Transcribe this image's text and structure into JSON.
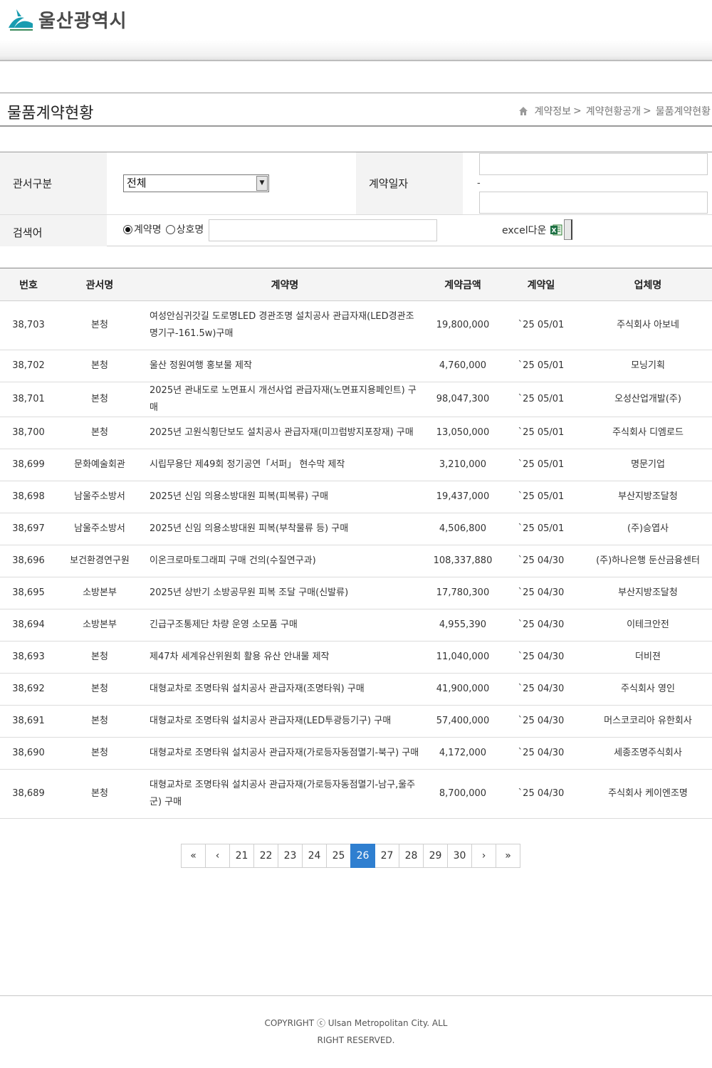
{
  "header": {
    "logo_text": "울산광역시",
    "colors": {
      "logo_blue": "#1a9cb0",
      "logo_green": "#3a8a5a"
    }
  },
  "title": {
    "text": "물품계약현황",
    "breadcrumb": [
      "계약정보",
      "계약현황공개",
      "물품계약현황"
    ],
    "breadcrumb_sep": ">"
  },
  "search": {
    "dept_label": "관서구분",
    "dept_selected": "전체",
    "date_label": "계약일자",
    "date_sep": "-",
    "keyword_label": "검색어",
    "radio_contract": "계약명",
    "radio_company": "상호명",
    "excel_label": "excel다운"
  },
  "table": {
    "headers": [
      "번호",
      "관서명",
      "계약명",
      "계약금액",
      "계약일",
      "업체명"
    ],
    "rows": [
      {
        "no": "38,703",
        "dept": "본청",
        "name": "여성안심귀갓길 도로명LED 경관조명 설치공사 관급자재(LED경관조명기구-161.5w)구매",
        "amount": "19,800,000",
        "date": "`25 05/01",
        "company": "주식회사 아보네"
      },
      {
        "no": "38,702",
        "dept": "본청",
        "name": "울산 정원여행 홍보물 제작",
        "amount": "4,760,000",
        "date": "`25 05/01",
        "company": "모닝기획"
      },
      {
        "no": "38,701",
        "dept": "본청",
        "name": "2025년 관내도로 노면표시 개선사업 관급자재(노면표지용페인트) 구매",
        "amount": "98,047,300",
        "date": "`25 05/01",
        "company": "오성산업개발(주)"
      },
      {
        "no": "38,700",
        "dept": "본청",
        "name": "2025년 고원식횡단보도 설치공사 관급자재(미끄럼방지포장재) 구매",
        "amount": "13,050,000",
        "date": "`25 05/01",
        "company": "주식회사 디엠로드"
      },
      {
        "no": "38,699",
        "dept": "문화예술회관",
        "name": "시립무용단 제49회 정기공연「서퍼」 현수막 제작",
        "amount": "3,210,000",
        "date": "`25 05/01",
        "company": "명문기업"
      },
      {
        "no": "38,698",
        "dept": "남울주소방서",
        "name": "2025년 신임 의용소방대원 피복(피복류) 구매",
        "amount": "19,437,000",
        "date": "`25 05/01",
        "company": "부산지방조달청"
      },
      {
        "no": "38,697",
        "dept": "남울주소방서",
        "name": "2025년 신임 의용소방대원 피복(부착물류 등) 구매",
        "amount": "4,506,800",
        "date": "`25 05/01",
        "company": "(주)승엽사"
      },
      {
        "no": "38,696",
        "dept": "보건환경연구원",
        "name": "이온크로마토그래피 구매 건의(수질연구과)",
        "amount": "108,337,880",
        "date": "`25 04/30",
        "company": "(주)하나은행 둔산금융센터"
      },
      {
        "no": "38,695",
        "dept": "소방본부",
        "name": "2025년 상반기 소방공무원 피복 조달 구매(신발류)",
        "amount": "17,780,300",
        "date": "`25 04/30",
        "company": "부산지방조달청"
      },
      {
        "no": "38,694",
        "dept": "소방본부",
        "name": "긴급구조통제단 차량 운영 소모품 구매",
        "amount": "4,955,390",
        "date": "`25 04/30",
        "company": "이테크안전"
      },
      {
        "no": "38,693",
        "dept": "본청",
        "name": "제47차 세계유산위원회 활용 유산 안내물 제작",
        "amount": "11,040,000",
        "date": "`25 04/30",
        "company": "더비젼"
      },
      {
        "no": "38,692",
        "dept": "본청",
        "name": "대형교차로 조명타워 설치공사 관급자재(조명타워) 구매",
        "amount": "41,900,000",
        "date": "`25 04/30",
        "company": "주식회사 영인"
      },
      {
        "no": "38,691",
        "dept": "본청",
        "name": "대형교차로 조명타워 설치공사 관급자재(LED투광등기구) 구매",
        "amount": "57,400,000",
        "date": "`25 04/30",
        "company": "머스코코리아 유한회사"
      },
      {
        "no": "38,690",
        "dept": "본청",
        "name": "대형교차로 조명타워 설치공사 관급자재(가로등자동점멸기-북구) 구매",
        "amount": "4,172,000",
        "date": "`25 04/30",
        "company": "세종조명주식회사"
      },
      {
        "no": "38,689",
        "dept": "본청",
        "name": "대형교차로 조명타워 설치공사 관급자재(가로등자동점멸기-남구,울주군) 구매",
        "amount": "8,700,000",
        "date": "`25 04/30",
        "company": "주식회사 케이엔조명"
      }
    ]
  },
  "pagination": {
    "first": "«",
    "prev": "‹",
    "pages": [
      "21",
      "22",
      "23",
      "24",
      "25",
      "26",
      "27",
      "28",
      "29",
      "30"
    ],
    "current": "26",
    "next": "›",
    "last": "»",
    "active_color": "#2f7fd0"
  },
  "footer": {
    "copyright": "COPYRIGHT ⓒ Ulsan Metropolitan City. ALL RIGHT RESERVED."
  }
}
